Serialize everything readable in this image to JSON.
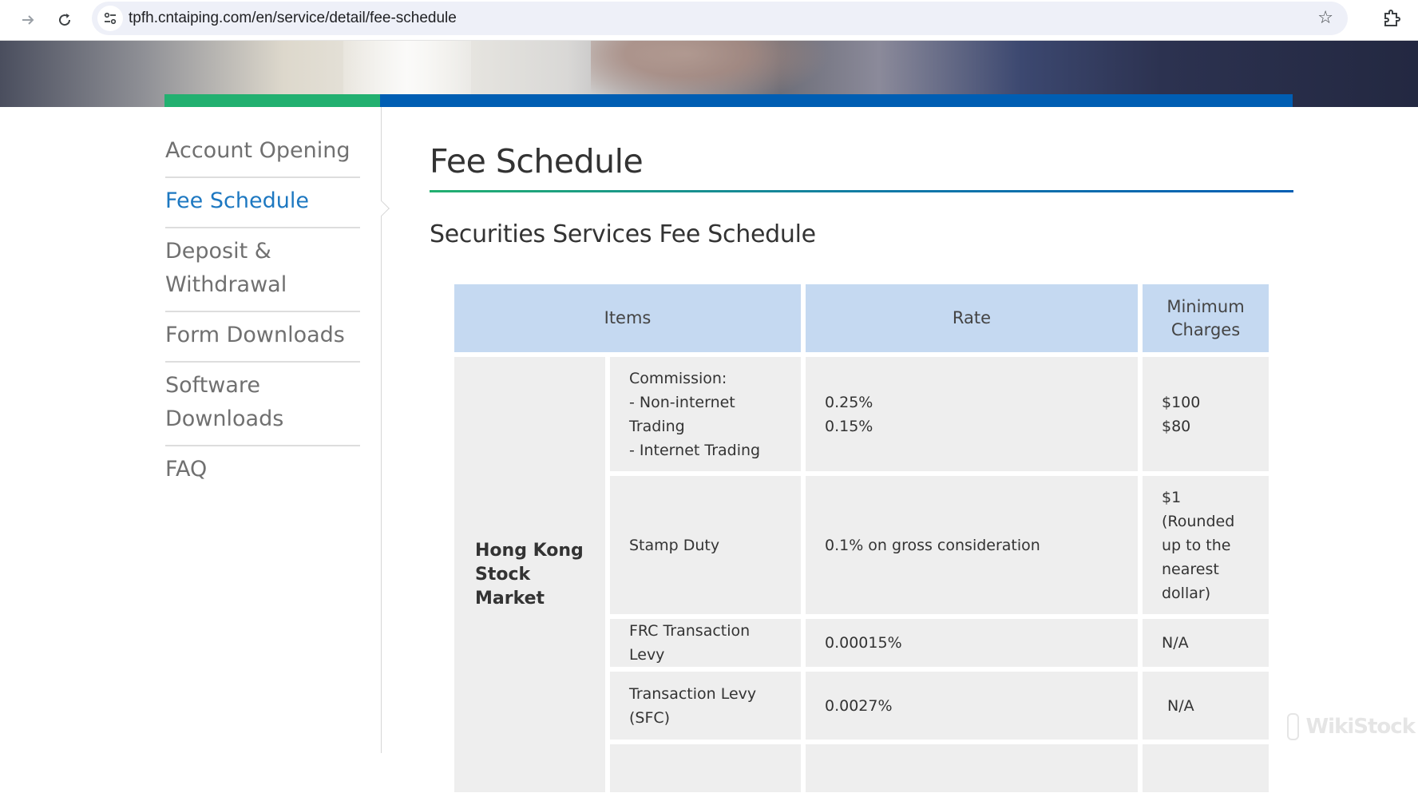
{
  "browser": {
    "url": "tpfh.cntaiping.com/en/service/detail/fee-schedule",
    "icons": [
      "forward-arrow-icon",
      "reload-icon",
      "site-info-icon",
      "bookmark-star-icon",
      "extensions-icon"
    ]
  },
  "brand_colors": {
    "green": "#22b070",
    "blue": "#005eb3",
    "active_link": "#1d78c1",
    "table_header": "#c5d9f1",
    "table_cell": "#eeeeee"
  },
  "sidebar": {
    "items": [
      {
        "label": "Account Opening",
        "active": false
      },
      {
        "label": "Fee Schedule",
        "active": true
      },
      {
        "label": "Deposit & Withdrawal",
        "lines": [
          "Deposit &",
          "Withdrawal"
        ],
        "active": false
      },
      {
        "label": "Form Downloads",
        "active": false
      },
      {
        "label": "Software Downloads",
        "lines": [
          "Software",
          "Downloads"
        ],
        "active": false
      },
      {
        "label": "FAQ",
        "active": false
      }
    ]
  },
  "main": {
    "title": "Fee Schedule",
    "subtitle": "Securities Services Fee Schedule",
    "table": {
      "headers": {
        "items": "Items",
        "rate": "Rate",
        "minimum": [
          "Minimum",
          "Charges"
        ]
      },
      "market": [
        "Hong Kong",
        "Stock",
        "Market"
      ],
      "rows": [
        {
          "item": [
            "Commission:",
            "- Non-internet",
            "Trading",
            "- Internet Trading"
          ],
          "rate": [
            "0.25%",
            "0.15%"
          ],
          "minimum": [
            "$100",
            "$80"
          ]
        },
        {
          "item": [
            "Stamp Duty"
          ],
          "rate": [
            "0.1% on gross consideration"
          ],
          "minimum": [
            "$1",
            "(Rounded",
            "up to the",
            "nearest",
            "dollar)"
          ]
        },
        {
          "item": [
            "FRC Transaction Levy"
          ],
          "rate": [
            "0.00015%"
          ],
          "minimum": [
            "N/A"
          ]
        },
        {
          "item": [
            "Transaction Levy",
            "(SFC)"
          ],
          "rate": [
            "0.0027%"
          ],
          "minimum": [
            "N/A"
          ]
        }
      ]
    }
  },
  "watermark": {
    "text": "WikiStock"
  }
}
